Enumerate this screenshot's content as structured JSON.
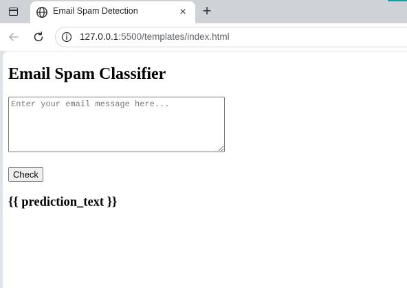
{
  "browser": {
    "tab": {
      "title": "Email Spam Detection",
      "favicon": "globe-icon",
      "close": "×"
    },
    "new_tab": "+",
    "address": {
      "host": "127.0.0.1",
      "rest": ":5500/templates/index.html"
    },
    "colors": {
      "tabstrip": "#cfd3d8",
      "accent": "#0fa3a3"
    }
  },
  "page": {
    "title": "Email Spam Classifier",
    "message_placeholder": "Enter your email message here...",
    "message_value": "",
    "check_label": "Check",
    "prediction": "{{ prediction_text }}"
  }
}
